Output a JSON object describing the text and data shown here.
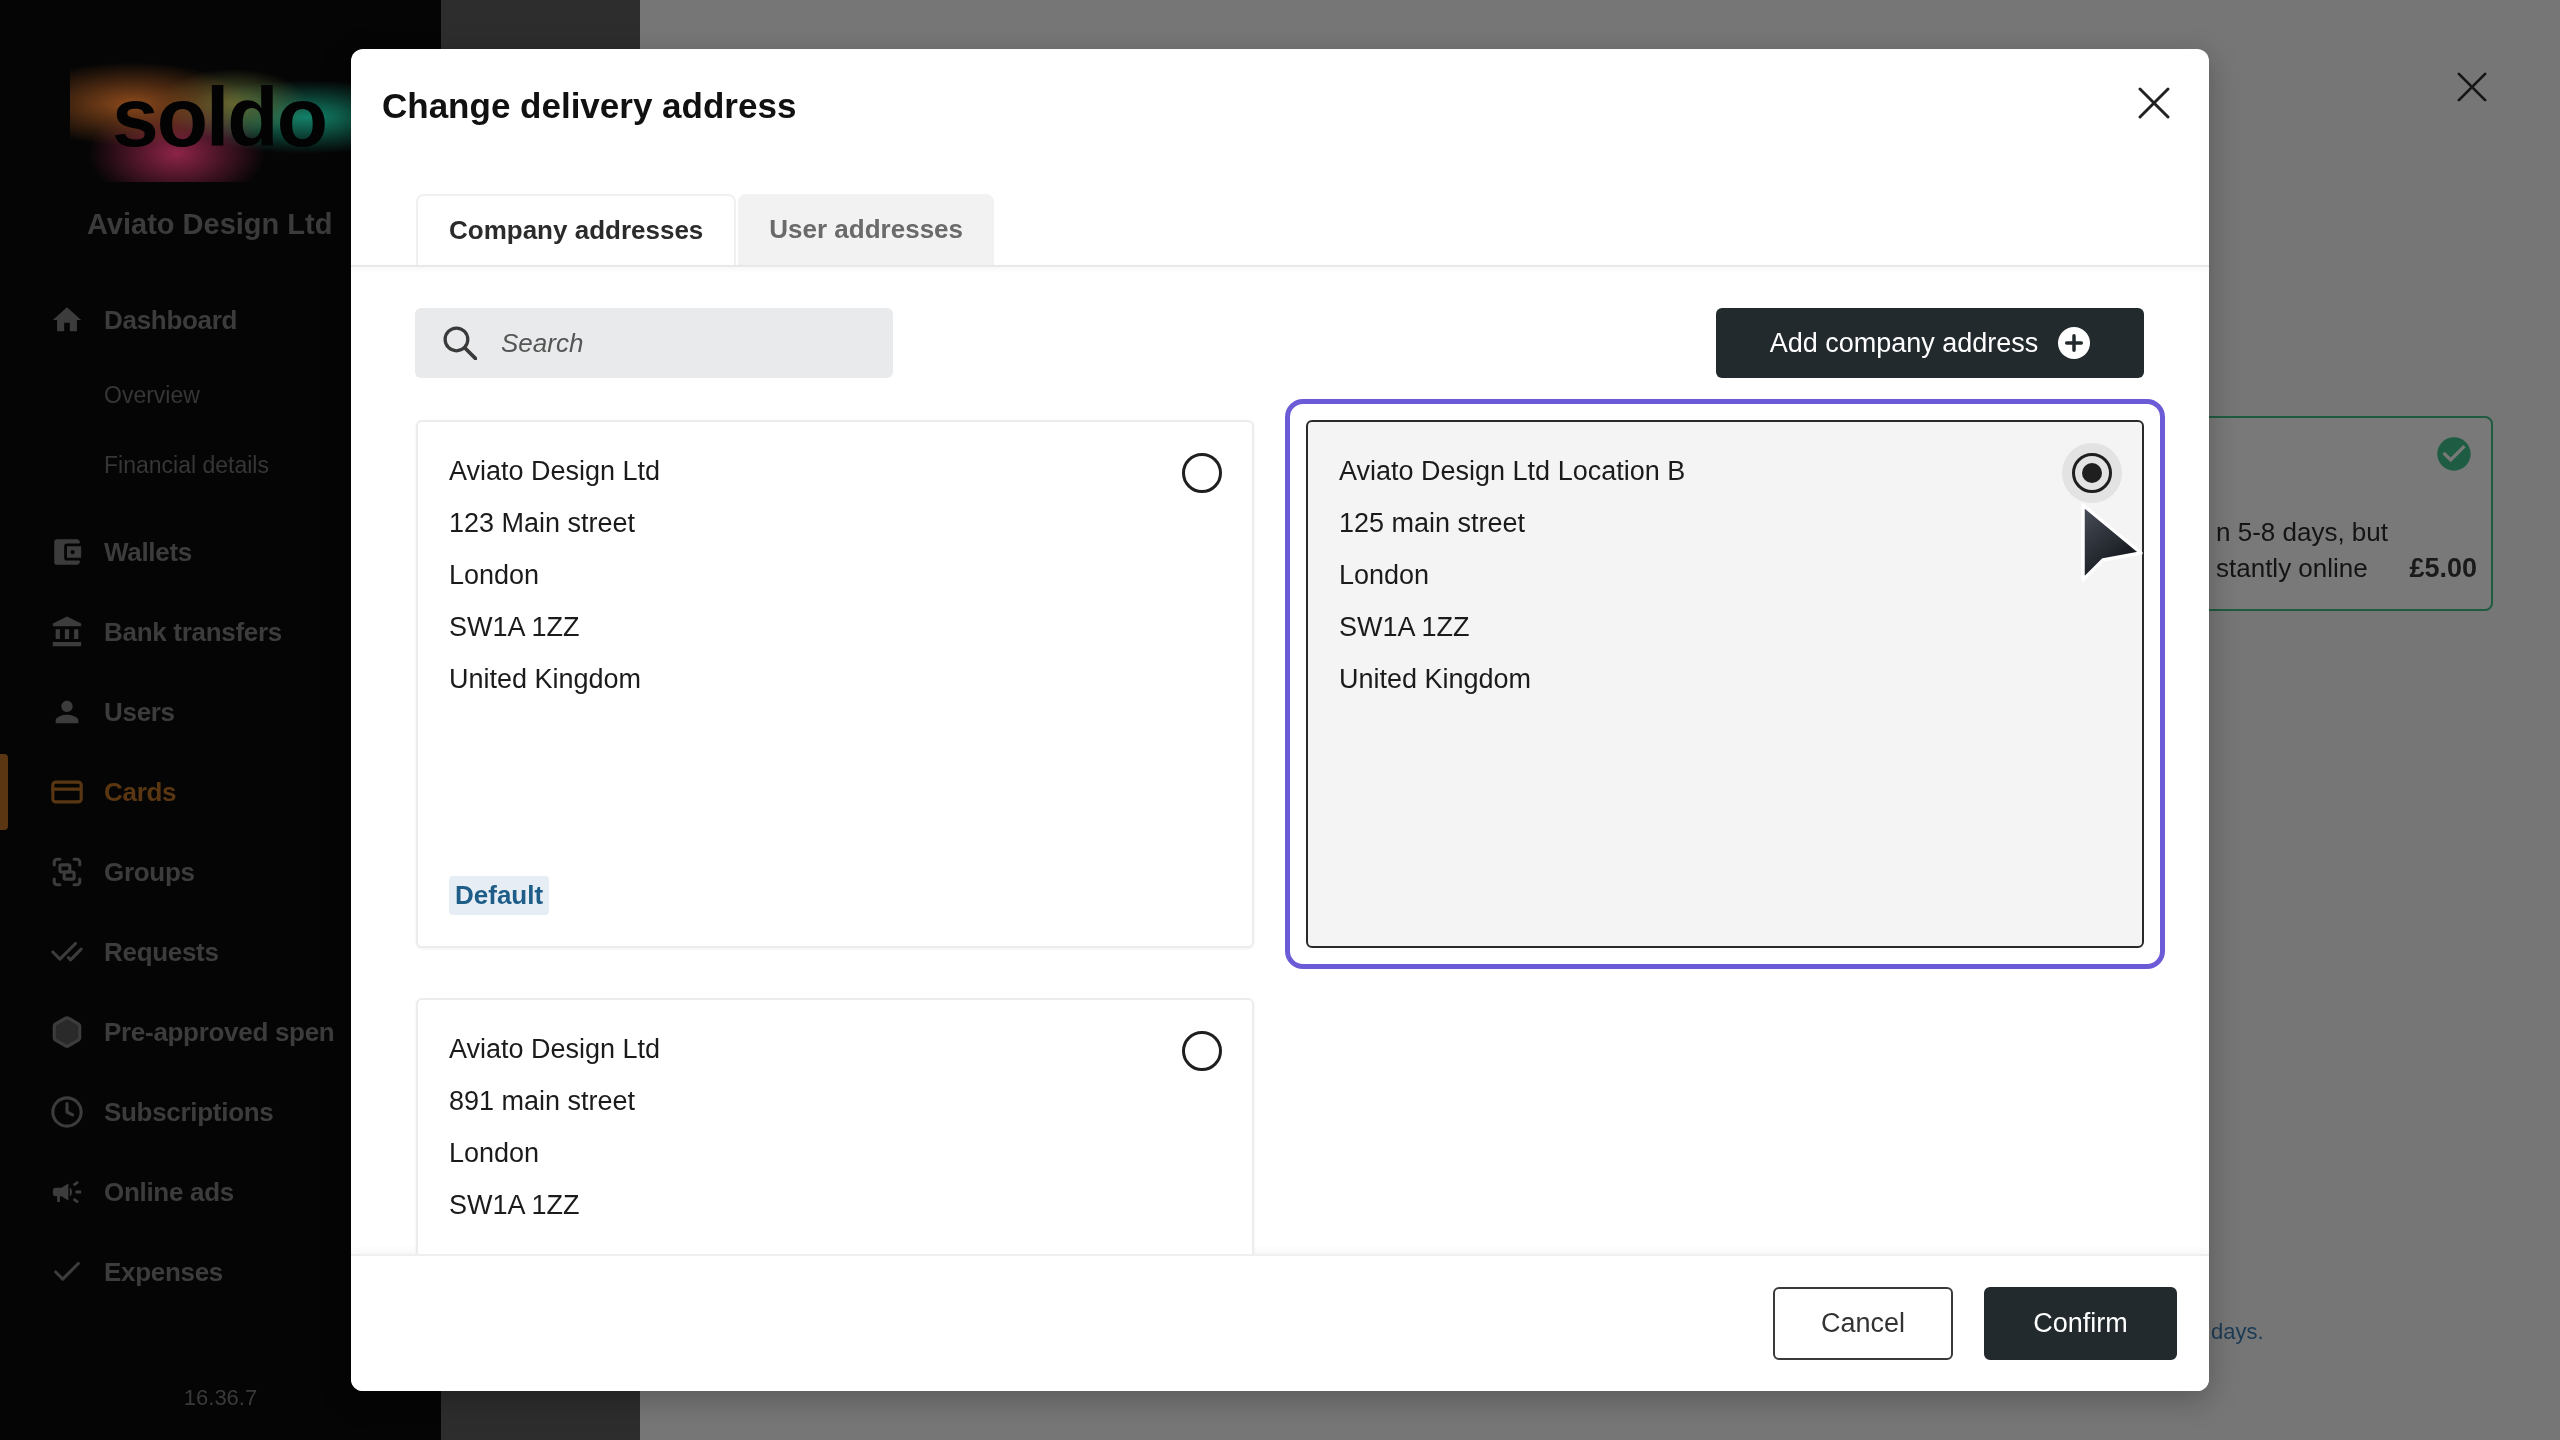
{
  "sidebar": {
    "logo": "soldo",
    "company": "Aviato Design Ltd",
    "items": [
      {
        "label": "Dashboard",
        "selected": false,
        "children": [
          {
            "label": "Overview",
            "selected": false
          },
          {
            "label": "Financial details",
            "selected": false
          }
        ]
      },
      {
        "label": "Wallets",
        "selected": false
      },
      {
        "label": "Bank transfers",
        "selected": false
      },
      {
        "label": "Users",
        "selected": false
      },
      {
        "label": "Cards",
        "selected": true
      },
      {
        "label": "Groups",
        "selected": false
      },
      {
        "label": "Requests",
        "selected": false
      },
      {
        "label": "Pre-approved spen",
        "selected": false
      },
      {
        "label": "Subscriptions",
        "selected": false
      },
      {
        "label": "Online ads",
        "selected": false
      },
      {
        "label": "Expenses",
        "selected": false
      }
    ],
    "version": "16.36.7"
  },
  "drawer": {
    "option": {
      "lines": [
        "n 5-8 days, but",
        "stantly online"
      ],
      "price": "£5.00",
      "checked": true
    },
    "note": "days."
  },
  "modal": {
    "title": "Change delivery address",
    "tabs": [
      {
        "label": "Company addresses",
        "selected": true
      },
      {
        "label": "User addresses",
        "selected": false
      }
    ],
    "search": {
      "placeholder": "Search"
    },
    "add_button": "Add company address",
    "addresses": [
      {
        "lines": [
          "Aviato Design Ltd",
          "123 Main street",
          "London",
          "SW1A 1ZZ",
          "United Kingdom"
        ],
        "badge": "Default",
        "selected": false,
        "focused": false
      },
      {
        "lines": [
          "Aviato Design Ltd Location B",
          "125 main street",
          "London",
          "SW1A 1ZZ",
          "United Kingdom"
        ],
        "selected": true,
        "focused": true
      },
      {
        "lines": [
          "Aviato Design Ltd",
          "891 main street",
          "London",
          "SW1A 1ZZ"
        ],
        "selected": false,
        "focused": false
      }
    ],
    "buttons": [
      {
        "label": "Cancel",
        "kind": "secondary"
      },
      {
        "label": "Confirm",
        "kind": "primary"
      }
    ]
  }
}
